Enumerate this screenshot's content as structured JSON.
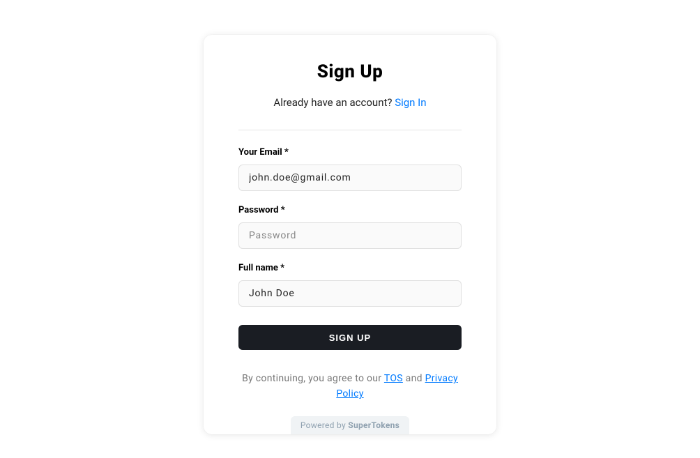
{
  "title": "Sign Up",
  "subtitle": {
    "text": "Already have an account? ",
    "link": "Sign In"
  },
  "fields": {
    "email": {
      "label": "Your Email *",
      "value": "john.doe@gmail.com",
      "placeholder": ""
    },
    "password": {
      "label": "Password *",
      "value": "",
      "placeholder": "Password"
    },
    "fullname": {
      "label": "Full name *",
      "value": "John Doe",
      "placeholder": ""
    }
  },
  "submit": "SIGN UP",
  "terms": {
    "prefix": "By continuing, you agree to our ",
    "tos": "TOS",
    "mid": " and ",
    "privacy": "Privacy Policy"
  },
  "poweredBy": {
    "prefix": "Powered by ",
    "brand": "SuperTokens"
  }
}
